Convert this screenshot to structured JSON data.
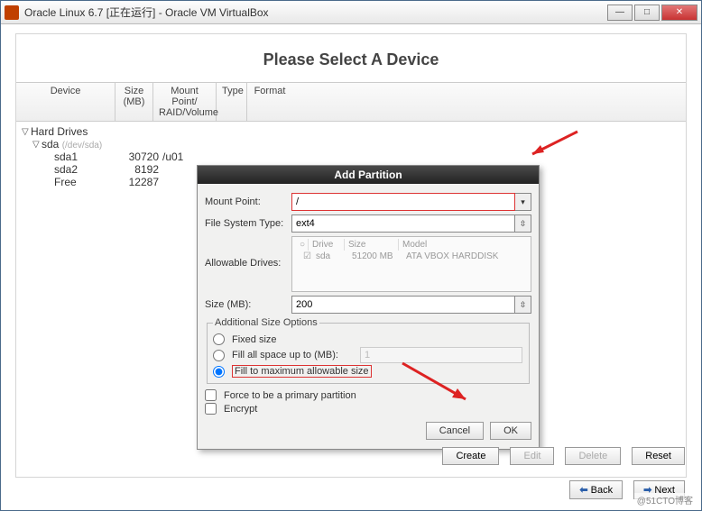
{
  "window": {
    "title": "Oracle Linux 6.7 [正在运行] - Oracle VM VirtualBox"
  },
  "heading": "Please Select A Device",
  "columns": {
    "device": "Device",
    "size": "Size (MB)",
    "mount": "Mount Point/ RAID/Volume",
    "type": "Type",
    "format": "Format"
  },
  "tree": {
    "root": "Hard Drives",
    "disk": "sda",
    "disk_path": "(/dev/sda)",
    "rows": [
      {
        "name": "sda1",
        "size": "30720",
        "mp": "/u01"
      },
      {
        "name": "sda2",
        "size": "8192",
        "mp": ""
      },
      {
        "name": "Free",
        "size": "12287",
        "mp": ""
      }
    ]
  },
  "dialog": {
    "title": "Add Partition",
    "labels": {
      "mount": "Mount Point:",
      "fstype": "File System Type:",
      "drives": "Allowable Drives:",
      "size": "Size (MB):",
      "opts": "Additional Size Options",
      "fixed": "Fixed size",
      "fill_up": "Fill all space up to (MB):",
      "fill_max": "Fill to maximum allowable size",
      "force": "Force to be a primary partition",
      "encrypt": "Encrypt",
      "cancel": "Cancel",
      "ok": "OK"
    },
    "values": {
      "mount": "/",
      "fstype": "ext4",
      "size": "200",
      "fill_up_val": "1"
    },
    "drive_table": {
      "h1": "Drive",
      "h2": "Size",
      "h3": "Model",
      "r1": "sda",
      "r2": "51200 MB",
      "r3": "ATA VBOX HARDDISK"
    }
  },
  "buttons": {
    "create": "Create",
    "edit": "Edit",
    "delete": "Delete",
    "reset": "Reset",
    "back": "Back",
    "next": "Next"
  },
  "watermark": "@51CTO博客"
}
